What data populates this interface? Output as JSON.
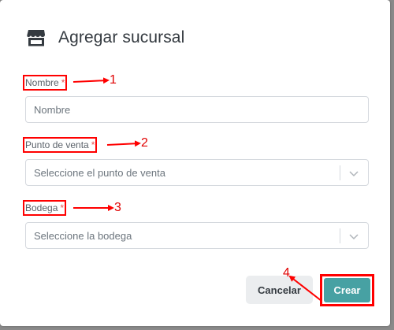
{
  "modal": {
    "title": "Agregar sucursal",
    "title_icon": "store-icon"
  },
  "form": {
    "nombre": {
      "label": "Nombre",
      "required_mark": "*",
      "placeholder": "Nombre",
      "value": ""
    },
    "punto_de_venta": {
      "label": "Punto de venta",
      "required_mark": "*",
      "placeholder": "Seleccione el punto de venta",
      "icon": "chevron-down-icon"
    },
    "bodega": {
      "label": "Bodega",
      "required_mark": "*",
      "placeholder": "Seleccione la bodega",
      "icon": "chevron-down-icon"
    }
  },
  "buttons": {
    "cancel_label": "Cancelar",
    "create_label": "Crear"
  },
  "annotations": {
    "n1": "1",
    "n2": "2",
    "n3": "3",
    "n4": "4",
    "color": "#ff0000"
  },
  "colors": {
    "accent": "#47a1a3",
    "required": "#e55353",
    "title": "#343a40"
  }
}
